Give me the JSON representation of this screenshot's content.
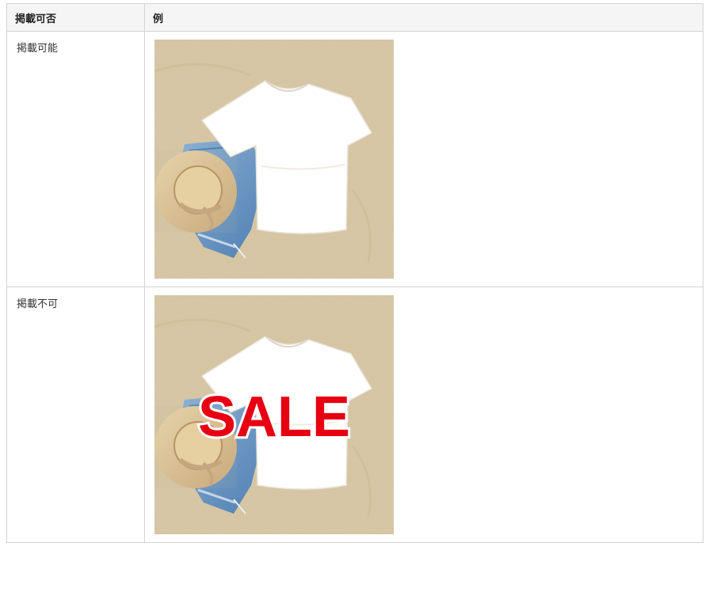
{
  "table": {
    "headers": [
      "掲載可否",
      "例"
    ],
    "rows": [
      {
        "status": "掲載可能",
        "example": {
          "photo": "white-tshirt-denim-shorts-straw-hat-on-sand",
          "overlay_text": ""
        }
      },
      {
        "status": "掲載不可",
        "example": {
          "photo": "white-tshirt-denim-shorts-straw-hat-on-sand",
          "overlay_text": "SALE"
        }
      }
    ]
  },
  "colors": {
    "sale_red": "#e60012",
    "sand": "#d9c9a6",
    "border": "#d4d4d4",
    "header_bg": "#f5f5f5"
  }
}
